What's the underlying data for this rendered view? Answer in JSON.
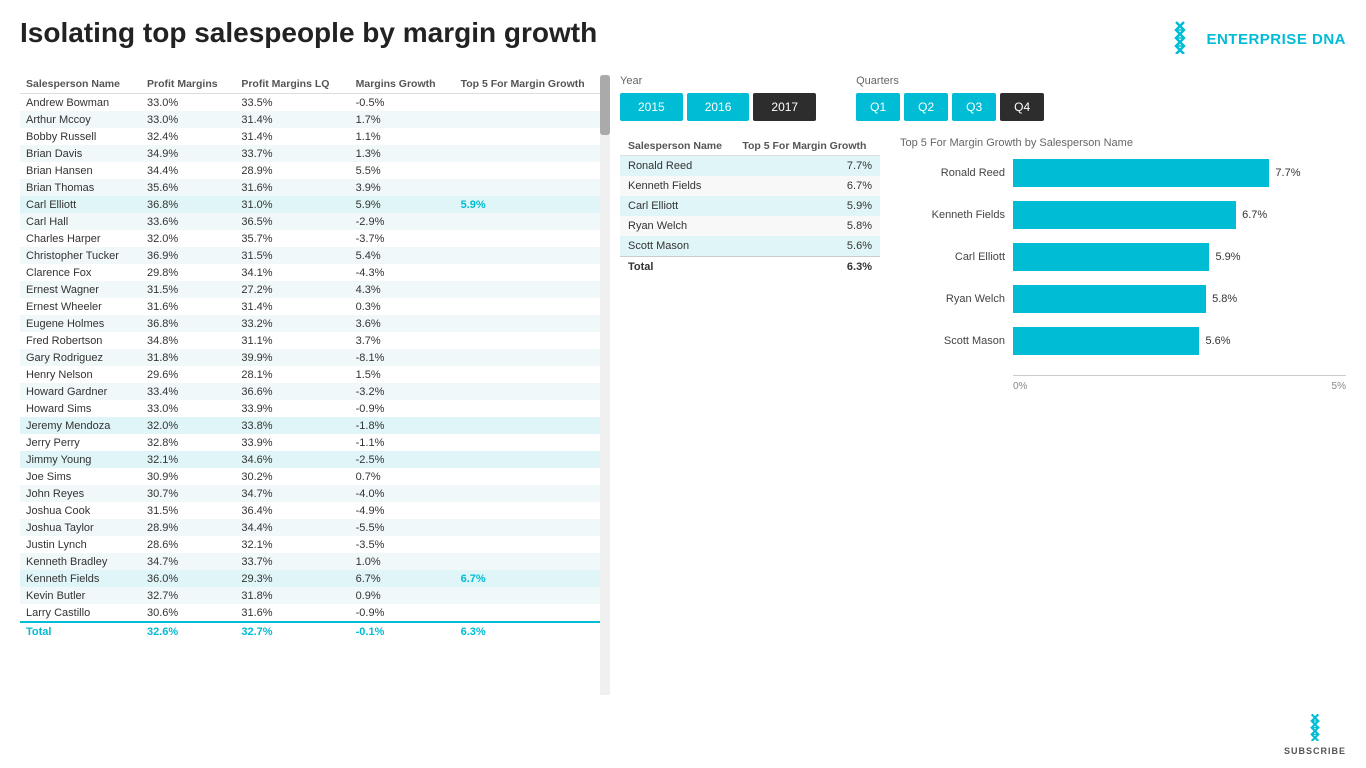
{
  "header": {
    "title": "Isolating top salespeople by margin growth",
    "logo_brand": "ENTERPRISE",
    "logo_accent": " DNA"
  },
  "table": {
    "columns": [
      "Salesperson Name",
      "Profit Margins",
      "Profit Margins LQ",
      "Margins Growth",
      "Top 5 For Margin Growth"
    ],
    "rows": [
      {
        "name": "Andrew Bowman",
        "pm": "33.0%",
        "pmlq": "33.5%",
        "mg": "-0.5%",
        "top5": ""
      },
      {
        "name": "Arthur Mccoy",
        "pm": "33.0%",
        "pmlq": "31.4%",
        "mg": "1.7%",
        "top5": ""
      },
      {
        "name": "Bobby Russell",
        "pm": "32.4%",
        "pmlq": "31.4%",
        "mg": "1.1%",
        "top5": ""
      },
      {
        "name": "Brian Davis",
        "pm": "34.9%",
        "pmlq": "33.7%",
        "mg": "1.3%",
        "top5": ""
      },
      {
        "name": "Brian Hansen",
        "pm": "34.4%",
        "pmlq": "28.9%",
        "mg": "5.5%",
        "top5": ""
      },
      {
        "name": "Brian Thomas",
        "pm": "35.6%",
        "pmlq": "31.6%",
        "mg": "3.9%",
        "top5": ""
      },
      {
        "name": "Carl Elliott",
        "pm": "36.8%",
        "pmlq": "31.0%",
        "mg": "5.9%",
        "top5": "5.9%",
        "highlighted": true
      },
      {
        "name": "Carl Hall",
        "pm": "33.6%",
        "pmlq": "36.5%",
        "mg": "-2.9%",
        "top5": ""
      },
      {
        "name": "Charles Harper",
        "pm": "32.0%",
        "pmlq": "35.7%",
        "mg": "-3.7%",
        "top5": ""
      },
      {
        "name": "Christopher Tucker",
        "pm": "36.9%",
        "pmlq": "31.5%",
        "mg": "5.4%",
        "top5": ""
      },
      {
        "name": "Clarence Fox",
        "pm": "29.8%",
        "pmlq": "34.1%",
        "mg": "-4.3%",
        "top5": ""
      },
      {
        "name": "Ernest Wagner",
        "pm": "31.5%",
        "pmlq": "27.2%",
        "mg": "4.3%",
        "top5": ""
      },
      {
        "name": "Ernest Wheeler",
        "pm": "31.6%",
        "pmlq": "31.4%",
        "mg": "0.3%",
        "top5": ""
      },
      {
        "name": "Eugene Holmes",
        "pm": "36.8%",
        "pmlq": "33.2%",
        "mg": "3.6%",
        "top5": ""
      },
      {
        "name": "Fred Robertson",
        "pm": "34.8%",
        "pmlq": "31.1%",
        "mg": "3.7%",
        "top5": ""
      },
      {
        "name": "Gary Rodriguez",
        "pm": "31.8%",
        "pmlq": "39.9%",
        "mg": "-8.1%",
        "top5": ""
      },
      {
        "name": "Henry Nelson",
        "pm": "29.6%",
        "pmlq": "28.1%",
        "mg": "1.5%",
        "top5": ""
      },
      {
        "name": "Howard Gardner",
        "pm": "33.4%",
        "pmlq": "36.6%",
        "mg": "-3.2%",
        "top5": ""
      },
      {
        "name": "Howard Sims",
        "pm": "33.0%",
        "pmlq": "33.9%",
        "mg": "-0.9%",
        "top5": ""
      },
      {
        "name": "Jeremy Mendoza",
        "pm": "32.0%",
        "pmlq": "33.8%",
        "mg": "-1.8%",
        "top5": "",
        "highlighted": true
      },
      {
        "name": "Jerry Perry",
        "pm": "32.8%",
        "pmlq": "33.9%",
        "mg": "-1.1%",
        "top5": ""
      },
      {
        "name": "Jimmy Young",
        "pm": "32.1%",
        "pmlq": "34.6%",
        "mg": "-2.5%",
        "top5": "",
        "highlighted": true
      },
      {
        "name": "Joe Sims",
        "pm": "30.9%",
        "pmlq": "30.2%",
        "mg": "0.7%",
        "top5": ""
      },
      {
        "name": "John Reyes",
        "pm": "30.7%",
        "pmlq": "34.7%",
        "mg": "-4.0%",
        "top5": ""
      },
      {
        "name": "Joshua Cook",
        "pm": "31.5%",
        "pmlq": "36.4%",
        "mg": "-4.9%",
        "top5": ""
      },
      {
        "name": "Joshua Taylor",
        "pm": "28.9%",
        "pmlq": "34.4%",
        "mg": "-5.5%",
        "top5": ""
      },
      {
        "name": "Justin Lynch",
        "pm": "28.6%",
        "pmlq": "32.1%",
        "mg": "-3.5%",
        "top5": ""
      },
      {
        "name": "Kenneth Bradley",
        "pm": "34.7%",
        "pmlq": "33.7%",
        "mg": "1.0%",
        "top5": ""
      },
      {
        "name": "Kenneth Fields",
        "pm": "36.0%",
        "pmlq": "29.3%",
        "mg": "6.7%",
        "top5": "6.7%",
        "highlighted": true
      },
      {
        "name": "Kevin Butler",
        "pm": "32.7%",
        "pmlq": "31.8%",
        "mg": "0.9%",
        "top5": ""
      },
      {
        "name": "Larry Castillo",
        "pm": "30.6%",
        "pmlq": "31.6%",
        "mg": "-0.9%",
        "top5": ""
      }
    ],
    "footer": {
      "label": "Total",
      "pm": "32.6%",
      "pmlq": "32.7%",
      "mg": "-0.1%",
      "top5": "6.3%"
    }
  },
  "year_filter": {
    "label": "Year",
    "options": [
      "2015",
      "2016",
      "2017"
    ],
    "active": "2017"
  },
  "quarter_filter": {
    "label": "Quarters",
    "options": [
      "Q1",
      "Q2",
      "Q3",
      "Q4"
    ],
    "active": "Q4"
  },
  "mini_table": {
    "col1": "Salesperson Name",
    "col2": "Top 5 For Margin Growth",
    "rows": [
      {
        "name": "Ronald Reed",
        "val": "7.7%"
      },
      {
        "name": "Kenneth Fields",
        "val": "6.7%"
      },
      {
        "name": "Carl Elliott",
        "val": "5.9%"
      },
      {
        "name": "Ryan Welch",
        "val": "5.8%"
      },
      {
        "name": "Scott Mason",
        "val": "5.6%"
      }
    ],
    "footer": {
      "label": "Total",
      "val": "6.3%"
    }
  },
  "bar_chart": {
    "title": "Top 5 For Margin Growth by Salesperson Name",
    "bars": [
      {
        "label": "Ronald Reed",
        "value": 7.7,
        "display": "7.7%"
      },
      {
        "label": "Kenneth Fields",
        "value": 6.7,
        "display": "6.7%"
      },
      {
        "label": "Carl Elliott",
        "value": 5.9,
        "display": "5.9%"
      },
      {
        "label": "Ryan Welch",
        "value": 5.8,
        "display": "5.8%"
      },
      {
        "label": "Scott Mason",
        "value": 5.6,
        "display": "5.6%"
      }
    ],
    "axis_min": "0%",
    "axis_mid": "5%",
    "max_val": 10
  },
  "subscribe": {
    "label": "SUBSCRIBE"
  }
}
